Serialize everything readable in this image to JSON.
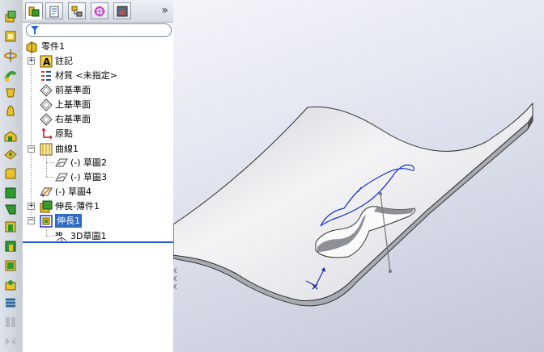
{
  "toolbar": {
    "icons": [
      "extruded-boss-icon",
      "extruded-base-icon",
      "revolve-icon",
      "sweep-icon",
      "loft-icon",
      "bell-icon",
      "extruded-cut-icon",
      "cut-icon",
      "fillet-icon",
      "chamfer-icon",
      "rib-icon",
      "shell-icon",
      "draft-icon",
      "hole-wizard-icon",
      "dome-icon",
      "flex-icon",
      "linear-pattern-icon"
    ]
  },
  "feature_manager": {
    "tabs": [
      "feature-tree-tab",
      "property-tab",
      "configuration-tab",
      "dim-expert-tab",
      "display-tab"
    ],
    "more_glyph": "»",
    "tree": [
      {
        "label": "零件1",
        "icon": "part-icon",
        "selected": false
      },
      {
        "label": "註記",
        "icon": "annotation-icon",
        "selected": false
      },
      {
        "label": "材質 <未指定>",
        "icon": "material-icon",
        "selected": false
      },
      {
        "label": "前基準面",
        "icon": "plane-icon",
        "selected": false
      },
      {
        "label": "上基準面",
        "icon": "plane-icon",
        "selected": false
      },
      {
        "label": "右基準面",
        "icon": "plane-icon",
        "selected": false
      },
      {
        "label": "原點",
        "icon": "origin-icon",
        "selected": false
      },
      {
        "label": "曲線1",
        "icon": "curve-icon",
        "selected": false
      },
      {
        "label": "(-) 草圖2",
        "icon": "sketch-icon",
        "selected": false
      },
      {
        "label": "(-) 草圖3",
        "icon": "sketch-icon",
        "selected": false
      },
      {
        "label": "(-) 草圖4",
        "icon": "sketch-edit-icon",
        "selected": false
      },
      {
        "label": "伸長-薄件1",
        "icon": "extrude-thin-icon",
        "selected": false
      },
      {
        "label": "伸長1",
        "icon": "extrude-cut-icon",
        "selected": true
      },
      {
        "label": "3D草圖1",
        "icon": "3d-sketch-icon",
        "selected": false
      }
    ]
  },
  "colors": {
    "selection": "#316ac5",
    "rollback_bar": "#1f5bd6",
    "curve": "#1530c8",
    "part_face": "#f0f0f2"
  }
}
